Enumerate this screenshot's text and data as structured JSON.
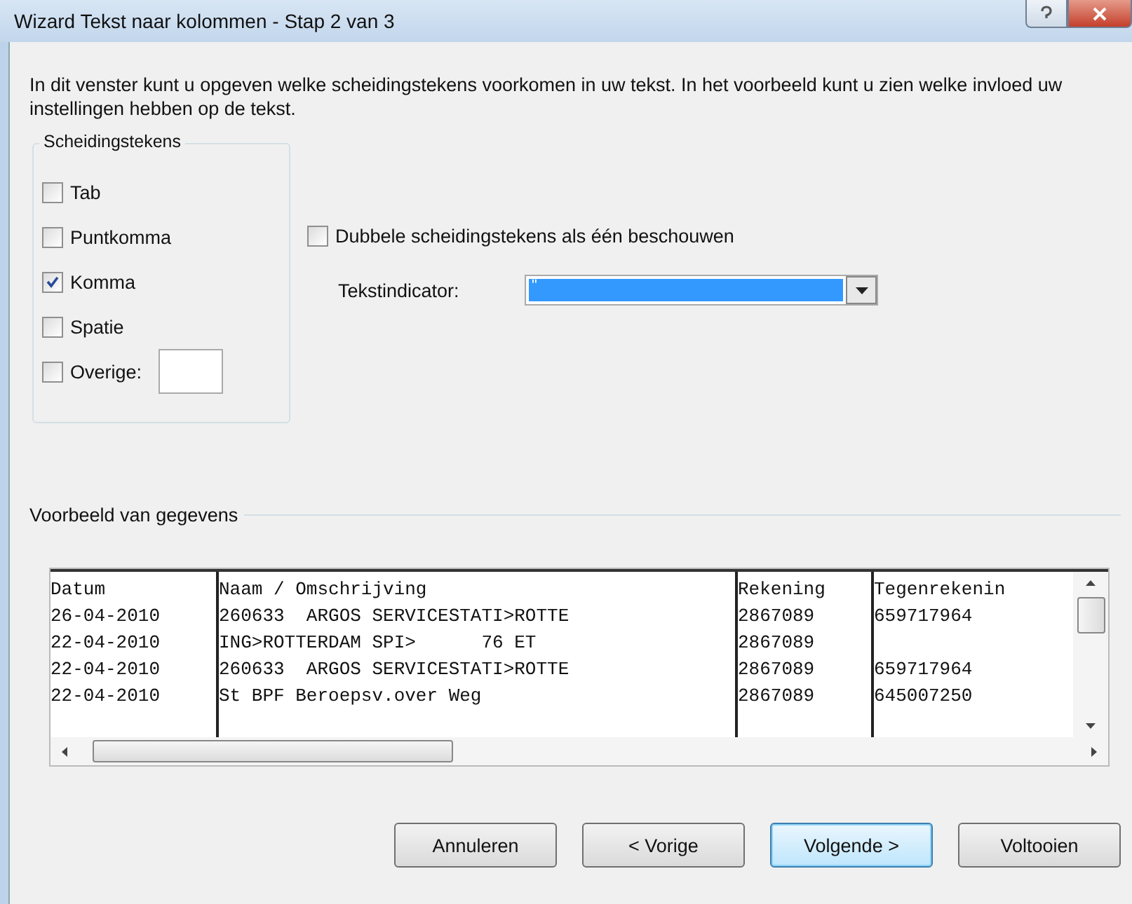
{
  "window": {
    "title": "Wizard Tekst naar kolommen - Stap 2 van 3"
  },
  "intro": "In dit venster kunt u opgeven welke scheidingstekens voorkomen in uw tekst. In het voorbeeld kunt u zien welke invloed uw instellingen hebben op de tekst.",
  "delimiters": {
    "title": "Scheidingstekens",
    "items": [
      {
        "label": "Tab",
        "checked": false
      },
      {
        "label": "Puntkomma",
        "checked": false
      },
      {
        "label": "Komma",
        "checked": true
      },
      {
        "label": "Spatie",
        "checked": false
      },
      {
        "label": "Overige:",
        "checked": false,
        "kind": "other"
      }
    ]
  },
  "double_delimiters": {
    "label": "Dubbele scheidingstekens als één beschouwen",
    "checked": false
  },
  "text_qualifier": {
    "label": "Tekstindicator:",
    "value": "\""
  },
  "preview": {
    "title": "Voorbeeld van gegevens",
    "columns": [
      {
        "header": "Datum",
        "cells": [
          "26-04-2010",
          "22-04-2010",
          "22-04-2010",
          "22-04-2010"
        ]
      },
      {
        "header": "Naam / Omschrijving",
        "cells": [
          "260633  ARGOS SERVICESTATI>ROTTE",
          "ING>ROTTERDAM SPI>      76 ET",
          "260633  ARGOS SERVICESTATI>ROTTE",
          "St BPF Beroepsv.over Weg"
        ]
      },
      {
        "header": "Rekening",
        "cells": [
          "2867089",
          "2867089",
          "2867089",
          "2867089"
        ]
      },
      {
        "header": "Tegenrekenin",
        "cells": [
          "659717964",
          "",
          "659717964",
          "645007250"
        ]
      }
    ]
  },
  "buttons": [
    {
      "label": "Annuleren",
      "default": false
    },
    {
      "label": "< Vorige",
      "default": false
    },
    {
      "label": "Volgende >",
      "default": true
    },
    {
      "label": "Voltooien",
      "default": false
    }
  ]
}
